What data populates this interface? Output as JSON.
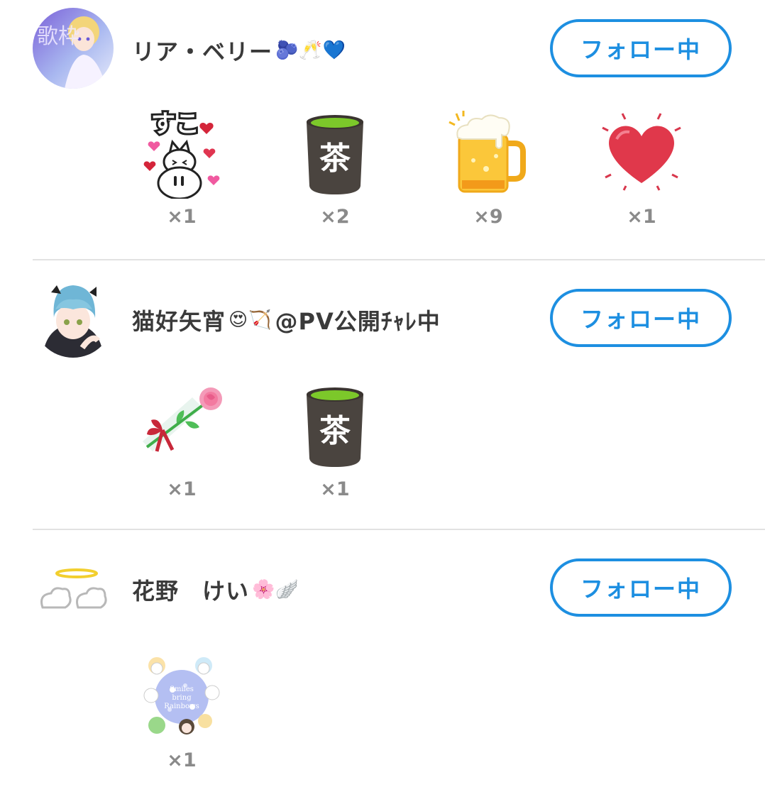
{
  "users": [
    {
      "name": "リア・ベリー",
      "name_emoji": "🫐🥂💙",
      "follow_label": "フォロー中",
      "gifts": [
        {
          "icon": "suko-cat-sticker-icon",
          "count": "×1"
        },
        {
          "icon": "green-tea-cup-icon",
          "count": "×2"
        },
        {
          "icon": "beer-mug-icon",
          "count": "×9"
        },
        {
          "icon": "red-heart-icon",
          "count": "×1"
        }
      ]
    },
    {
      "name": "猫好矢宵",
      "name_emoji": "😍🏹",
      "name_suffix": "@PV公開ﾁｬﾚ中",
      "follow_label": "フォロー中",
      "gifts": [
        {
          "icon": "rose-bouquet-icon",
          "count": "×1"
        },
        {
          "icon": "green-tea-cup-icon",
          "count": "×1"
        }
      ]
    },
    {
      "name": "花野　けい",
      "name_emoji": "🌸🪽",
      "follow_label": "フォロー中",
      "gifts": [
        {
          "icon": "smiles-bring-rainbows-sticker-icon",
          "count": "×1"
        }
      ]
    }
  ],
  "sticker_text": {
    "suko": "すこ",
    "tea_kanji": "茶",
    "avatar1_text": "歌枠",
    "rainbow_badge": "Smiles bring Rainbows"
  },
  "colors": {
    "accent": "#1d8fe1",
    "count_gray": "#8a8a8a",
    "divider": "#e2e2e2"
  }
}
